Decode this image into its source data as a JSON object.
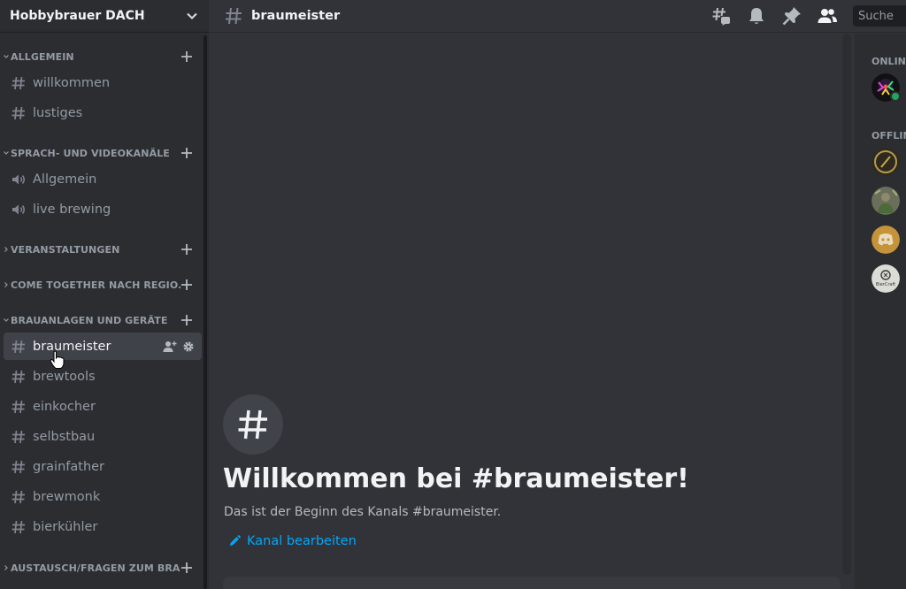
{
  "server": {
    "name": "Hobbybrauer DACH"
  },
  "categories": [
    {
      "label": "ALLGEMEIN"
    },
    {
      "label": "SPRACH- UND VIDEOKANÄLE"
    },
    {
      "label": "VERANSTALTUNGEN"
    },
    {
      "label": "COME TOGETHER NACH REGIO..."
    },
    {
      "label": "BRAUANLAGEN UND GERÄTE"
    },
    {
      "label": "AUSTAUSCH/FRAGEN ZUM BRA..."
    }
  ],
  "channels": [
    {
      "label": "willkommen",
      "type": "text"
    },
    {
      "label": "lustiges",
      "type": "text"
    },
    {
      "label": "Allgemein",
      "type": "voice"
    },
    {
      "label": "live brewing",
      "type": "voice"
    },
    {
      "label": "braumeister",
      "type": "text",
      "active": true
    },
    {
      "label": "brewtools",
      "type": "text"
    },
    {
      "label": "einkocher",
      "type": "text"
    },
    {
      "label": "selbstbau",
      "type": "text"
    },
    {
      "label": "grainfather",
      "type": "text"
    },
    {
      "label": "brewmonk",
      "type": "text"
    },
    {
      "label": "bierkühler",
      "type": "text"
    }
  ],
  "header": {
    "channel": "braumeister",
    "search_placeholder": "Suche",
    "icons": [
      "threads-icon",
      "notification-bell-icon",
      "pinned-messages-icon",
      "member-list-icon"
    ]
  },
  "welcome": {
    "title": "Willkommen bei #braumeister!",
    "subtitle": "Das ist der Beginn des Kanals #braumeister.",
    "edit_label": "Kanal bearbeiten"
  },
  "members": {
    "online_label": "ONLINE",
    "offline_label": "OFFLINE",
    "avatar_text_4": "BierCraft"
  },
  "colors": {
    "accent_link": "#00a8fc",
    "online_status": "#23a55a"
  }
}
